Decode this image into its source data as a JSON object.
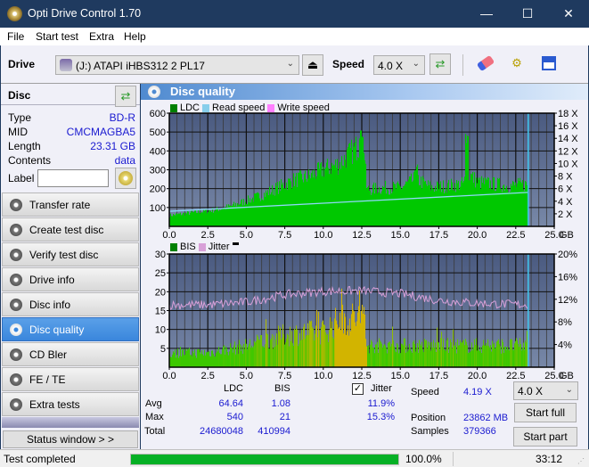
{
  "window": {
    "title": "Opti Drive Control 1.70",
    "minimize": "—",
    "maximize": "☐",
    "close": "✕"
  },
  "menu": [
    "File",
    "Start test",
    "Extra",
    "Help"
  ],
  "toolbar": {
    "drive_label": "Drive",
    "drive_value": "(J:)  ATAPI iHBS312  2 PL17",
    "speed_label": "Speed",
    "speed_value": "4.0 X"
  },
  "disc": {
    "header": "Disc",
    "rows": [
      {
        "k": "Type",
        "v": "BD-R"
      },
      {
        "k": "MID",
        "v": "CMCMAGBA5"
      },
      {
        "k": "Length",
        "v": "23.31 GB"
      },
      {
        "k": "Contents",
        "v": "data"
      }
    ],
    "label_label": "Label",
    "label_value": ""
  },
  "nav": [
    {
      "label": "Transfer rate",
      "active": false
    },
    {
      "label": "Create test disc",
      "active": false
    },
    {
      "label": "Verify test disc",
      "active": false
    },
    {
      "label": "Drive info",
      "active": false
    },
    {
      "label": "Disc info",
      "active": false
    },
    {
      "label": "Disc quality",
      "active": true
    },
    {
      "label": "CD Bler",
      "active": false
    },
    {
      "label": "FE / TE",
      "active": false
    },
    {
      "label": "Extra tests",
      "active": false
    }
  ],
  "status_window_label": "Status window > >",
  "panel": {
    "title": "Disc quality"
  },
  "chart_data": [
    {
      "type": "area",
      "title": "LDC / Read speed",
      "legend": [
        "LDC",
        "Read speed",
        "Write speed"
      ],
      "legend_colors": {
        "LDC": "#008000",
        "Read speed": "#87ceeb",
        "Write speed": "#ff80ff"
      },
      "xlabel": "GB",
      "xlim": [
        0,
        25
      ],
      "xticks": [
        "0.0",
        "2.5",
        "5.0",
        "7.5",
        "10.0",
        "12.5",
        "15.0",
        "17.5",
        "20.0",
        "22.5",
        "25.0"
      ],
      "ylim": [
        0,
        600
      ],
      "yticks": [
        "100",
        "200",
        "300",
        "400",
        "500",
        "600"
      ],
      "y2lim": [
        0,
        18
      ],
      "y2ticks": [
        "2 X",
        "4 X",
        "6 X",
        "8 X",
        "10 X",
        "12 X",
        "14 X",
        "16 X",
        "18 X"
      ],
      "end_marker_gb": 23.31,
      "ldc_profile": {
        "x": [
          0,
          1,
          2,
          3,
          4,
          5,
          6,
          7,
          8,
          9,
          10,
          11,
          12,
          12.6,
          12.8,
          14,
          15,
          16,
          17,
          18,
          19,
          19.5,
          20,
          21,
          22,
          23.3
        ],
        "y": [
          60,
          70,
          80,
          90,
          110,
          140,
          170,
          210,
          250,
          270,
          310,
          340,
          420,
          460,
          200,
          210,
          210,
          260,
          210,
          220,
          230,
          280,
          240,
          230,
          220,
          230
        ]
      },
      "ldc_peaks": [
        {
          "x": 12.4,
          "y": 540
        },
        {
          "x": 19.3,
          "y": 510
        },
        {
          "x": 16.0,
          "y": 330
        }
      ],
      "read_speed": {
        "x": [
          0,
          23.3
        ],
        "y": [
          2.4,
          5.4
        ]
      }
    },
    {
      "type": "area",
      "title": "BIS / Jitter",
      "legend": [
        "BIS",
        "Jitter"
      ],
      "legend_colors": {
        "BIS": "#008000",
        "Jitter": "#d8a0d8"
      },
      "xlabel": "GB",
      "xlim": [
        0,
        25
      ],
      "xticks": [
        "0.0",
        "2.5",
        "5.0",
        "7.5",
        "10.0",
        "12.5",
        "15.0",
        "17.5",
        "20.0",
        "22.5",
        "25.0"
      ],
      "ylim": [
        0,
        30
      ],
      "yticks": [
        "5",
        "10",
        "15",
        "20",
        "25",
        "30"
      ],
      "y2lim": [
        0,
        20
      ],
      "y2ticks": [
        "4%",
        "8%",
        "12%",
        "16%",
        "20%"
      ],
      "end_marker_gb": 23.31,
      "bis_profile": {
        "x": [
          0,
          2.5,
          5,
          7.5,
          10,
          11,
          12.5,
          12.8,
          15,
          17.5,
          20,
          23.3
        ],
        "y": [
          4,
          4,
          6,
          9,
          10,
          13,
          14,
          6,
          6,
          6,
          6,
          6
        ]
      },
      "jitter_profile": {
        "x": [
          0,
          2.5,
          5,
          7.5,
          10,
          12.5,
          15,
          17.5,
          20,
          23.3
        ],
        "y": [
          11.0,
          11.0,
          11.5,
          12.8,
          13.4,
          13.5,
          13.0,
          11.8,
          11.3,
          11.0
        ]
      }
    }
  ],
  "stats": {
    "col_ldc": "LDC",
    "col_bis": "BIS",
    "jitter_label": "Jitter",
    "jitter_checked": true,
    "rows": [
      {
        "label": "Avg",
        "ldc": "64.64",
        "bis": "1.08",
        "jitter": "11.9%"
      },
      {
        "label": "Max",
        "ldc": "540",
        "bis": "21",
        "jitter": "15.3%"
      },
      {
        "label": "Total",
        "ldc": "24680048",
        "bis": "410994",
        "jitter": ""
      }
    ],
    "speed_label": "Speed",
    "speed_value": "4.19 X",
    "position_label": "Position",
    "position_value": "23862 MB",
    "samples_label": "Samples",
    "samples_value": "379366",
    "speed_select": "4.0 X",
    "start_full": "Start full",
    "start_part": "Start part"
  },
  "statusbar": {
    "text": "Test completed",
    "progress_percent": 100.0,
    "progress_label": "100.0%",
    "time": "33:12"
  }
}
